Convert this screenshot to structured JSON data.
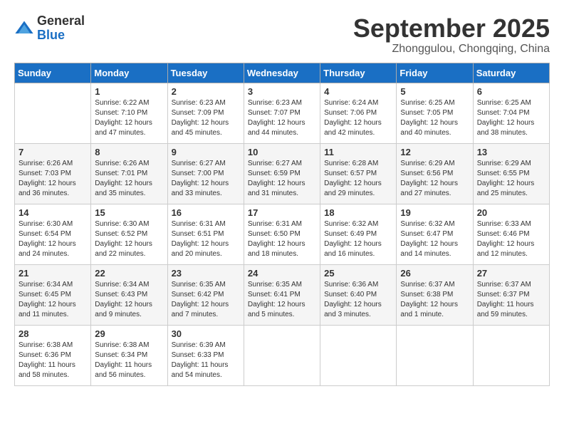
{
  "logo": {
    "general": "General",
    "blue": "Blue"
  },
  "title": "September 2025",
  "subtitle": "Zhonggulou, Chongqing, China",
  "headers": [
    "Sunday",
    "Monday",
    "Tuesday",
    "Wednesday",
    "Thursday",
    "Friday",
    "Saturday"
  ],
  "weeks": [
    [
      {
        "day": "",
        "info": ""
      },
      {
        "day": "1",
        "info": "Sunrise: 6:22 AM\nSunset: 7:10 PM\nDaylight: 12 hours\nand 47 minutes."
      },
      {
        "day": "2",
        "info": "Sunrise: 6:23 AM\nSunset: 7:09 PM\nDaylight: 12 hours\nand 45 minutes."
      },
      {
        "day": "3",
        "info": "Sunrise: 6:23 AM\nSunset: 7:07 PM\nDaylight: 12 hours\nand 44 minutes."
      },
      {
        "day": "4",
        "info": "Sunrise: 6:24 AM\nSunset: 7:06 PM\nDaylight: 12 hours\nand 42 minutes."
      },
      {
        "day": "5",
        "info": "Sunrise: 6:25 AM\nSunset: 7:05 PM\nDaylight: 12 hours\nand 40 minutes."
      },
      {
        "day": "6",
        "info": "Sunrise: 6:25 AM\nSunset: 7:04 PM\nDaylight: 12 hours\nand 38 minutes."
      }
    ],
    [
      {
        "day": "7",
        "info": "Sunrise: 6:26 AM\nSunset: 7:03 PM\nDaylight: 12 hours\nand 36 minutes."
      },
      {
        "day": "8",
        "info": "Sunrise: 6:26 AM\nSunset: 7:01 PM\nDaylight: 12 hours\nand 35 minutes."
      },
      {
        "day": "9",
        "info": "Sunrise: 6:27 AM\nSunset: 7:00 PM\nDaylight: 12 hours\nand 33 minutes."
      },
      {
        "day": "10",
        "info": "Sunrise: 6:27 AM\nSunset: 6:59 PM\nDaylight: 12 hours\nand 31 minutes."
      },
      {
        "day": "11",
        "info": "Sunrise: 6:28 AM\nSunset: 6:57 PM\nDaylight: 12 hours\nand 29 minutes."
      },
      {
        "day": "12",
        "info": "Sunrise: 6:29 AM\nSunset: 6:56 PM\nDaylight: 12 hours\nand 27 minutes."
      },
      {
        "day": "13",
        "info": "Sunrise: 6:29 AM\nSunset: 6:55 PM\nDaylight: 12 hours\nand 25 minutes."
      }
    ],
    [
      {
        "day": "14",
        "info": "Sunrise: 6:30 AM\nSunset: 6:54 PM\nDaylight: 12 hours\nand 24 minutes."
      },
      {
        "day": "15",
        "info": "Sunrise: 6:30 AM\nSunset: 6:52 PM\nDaylight: 12 hours\nand 22 minutes."
      },
      {
        "day": "16",
        "info": "Sunrise: 6:31 AM\nSunset: 6:51 PM\nDaylight: 12 hours\nand 20 minutes."
      },
      {
        "day": "17",
        "info": "Sunrise: 6:31 AM\nSunset: 6:50 PM\nDaylight: 12 hours\nand 18 minutes."
      },
      {
        "day": "18",
        "info": "Sunrise: 6:32 AM\nSunset: 6:49 PM\nDaylight: 12 hours\nand 16 minutes."
      },
      {
        "day": "19",
        "info": "Sunrise: 6:32 AM\nSunset: 6:47 PM\nDaylight: 12 hours\nand 14 minutes."
      },
      {
        "day": "20",
        "info": "Sunrise: 6:33 AM\nSunset: 6:46 PM\nDaylight: 12 hours\nand 12 minutes."
      }
    ],
    [
      {
        "day": "21",
        "info": "Sunrise: 6:34 AM\nSunset: 6:45 PM\nDaylight: 12 hours\nand 11 minutes."
      },
      {
        "day": "22",
        "info": "Sunrise: 6:34 AM\nSunset: 6:43 PM\nDaylight: 12 hours\nand 9 minutes."
      },
      {
        "day": "23",
        "info": "Sunrise: 6:35 AM\nSunset: 6:42 PM\nDaylight: 12 hours\nand 7 minutes."
      },
      {
        "day": "24",
        "info": "Sunrise: 6:35 AM\nSunset: 6:41 PM\nDaylight: 12 hours\nand 5 minutes."
      },
      {
        "day": "25",
        "info": "Sunrise: 6:36 AM\nSunset: 6:40 PM\nDaylight: 12 hours\nand 3 minutes."
      },
      {
        "day": "26",
        "info": "Sunrise: 6:37 AM\nSunset: 6:38 PM\nDaylight: 12 hours\nand 1 minute."
      },
      {
        "day": "27",
        "info": "Sunrise: 6:37 AM\nSunset: 6:37 PM\nDaylight: 11 hours\nand 59 minutes."
      }
    ],
    [
      {
        "day": "28",
        "info": "Sunrise: 6:38 AM\nSunset: 6:36 PM\nDaylight: 11 hours\nand 58 minutes."
      },
      {
        "day": "29",
        "info": "Sunrise: 6:38 AM\nSunset: 6:34 PM\nDaylight: 11 hours\nand 56 minutes."
      },
      {
        "day": "30",
        "info": "Sunrise: 6:39 AM\nSunset: 6:33 PM\nDaylight: 11 hours\nand 54 minutes."
      },
      {
        "day": "",
        "info": ""
      },
      {
        "day": "",
        "info": ""
      },
      {
        "day": "",
        "info": ""
      },
      {
        "day": "",
        "info": ""
      }
    ]
  ]
}
